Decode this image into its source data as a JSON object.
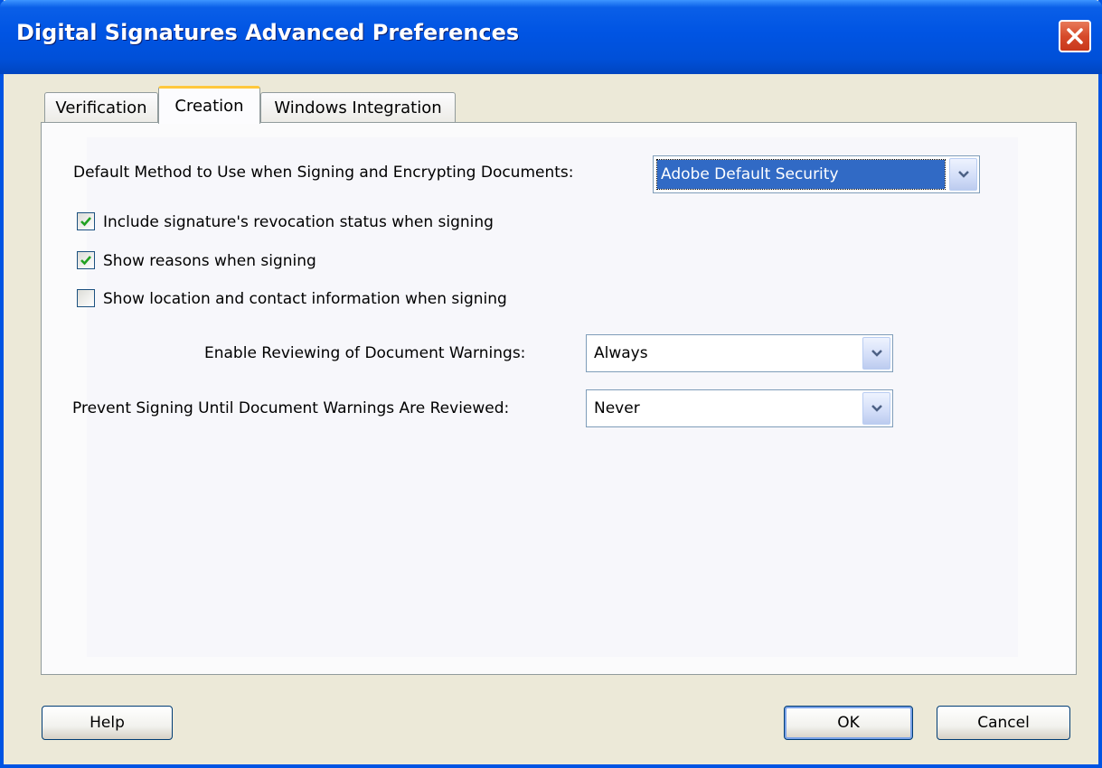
{
  "window": {
    "title": "Digital Signatures Advanced Preferences"
  },
  "tabs": [
    {
      "label": "Verification",
      "active": false
    },
    {
      "label": "Creation",
      "active": true
    },
    {
      "label": "Windows Integration",
      "active": false
    }
  ],
  "creation": {
    "default_method": {
      "label": "Default Method to Use when Signing and Encrypting Documents:",
      "value": "Adobe Default Security"
    },
    "checkboxes": [
      {
        "label": "Include signature's revocation status when signing",
        "checked": true
      },
      {
        "label": "Show reasons when signing",
        "checked": true
      },
      {
        "label": "Show location and contact information when signing",
        "checked": false
      }
    ],
    "enable_reviewing": {
      "label": "Enable Reviewing of Document Warnings:",
      "value": "Always"
    },
    "prevent_signing": {
      "label": "Prevent Signing Until Document Warnings Are Reviewed:",
      "value": "Never"
    }
  },
  "buttons": {
    "help": "Help",
    "ok": "OK",
    "cancel": "Cancel"
  },
  "icons": {
    "close": "close-icon",
    "check": "check-icon",
    "dropdown": "chevron-down-icon"
  },
  "colors": {
    "titlebar": "#0054e3",
    "selection": "#316ac5",
    "tab_highlight": "#ffc83c",
    "check": "#21a121"
  }
}
